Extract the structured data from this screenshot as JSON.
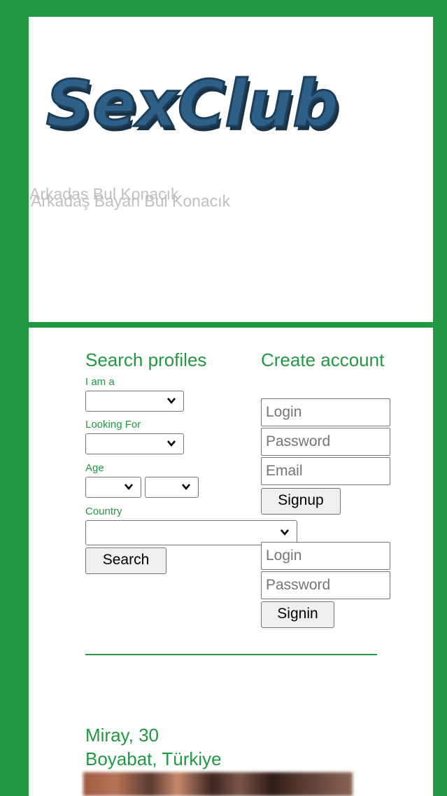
{
  "header": {
    "logo_text": "SexClub",
    "tagline_back": "Arkadas Bul Konacık",
    "tagline_front": "Arkadaş Bayan Bul Konacık"
  },
  "search": {
    "title": "Search profiles",
    "i_am_label": "I am a",
    "i_am_value": "",
    "looking_for_label": "Looking For",
    "looking_for_value": "",
    "age_label": "Age",
    "age_from_value": "",
    "age_to_value": "",
    "country_label": "Country",
    "country_value": "",
    "search_button": "Search"
  },
  "signup": {
    "title": "Create account",
    "login_placeholder": "Login",
    "password_placeholder": "Password",
    "email_placeholder": "Email",
    "signup_button": "Signup"
  },
  "signin": {
    "login_placeholder": "Login",
    "password_placeholder": "Password",
    "signin_button": "Signin"
  },
  "profile": {
    "name_age": "Miray, 30",
    "location": "Boyabat, Türkiye"
  },
  "colors": {
    "brand_green": "#209942",
    "logo_blue": "#2e5f86"
  },
  "icons": {
    "select_arrow": "chevron-down-icon"
  }
}
